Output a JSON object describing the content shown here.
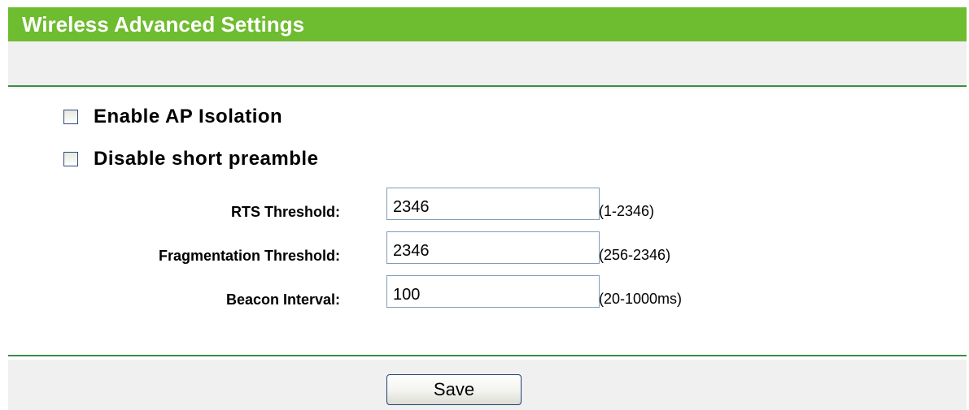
{
  "header": {
    "title": "Wireless Advanced Settings",
    "bar_color": "#6ebc2f",
    "rule_color": "#3a8f46"
  },
  "options": {
    "ap_isolation": {
      "label": "Enable AP Isolation",
      "checked": false
    },
    "short_preamble": {
      "label": "Disable short preamble",
      "checked": false
    }
  },
  "fields": {
    "rts": {
      "label": "RTS Threshold:",
      "value": "2346",
      "range": "(1-2346)"
    },
    "fragmentation": {
      "label": "Fragmentation Threshold:",
      "value": "2346",
      "range": "(256-2346)"
    },
    "beacon": {
      "label": "Beacon Interval:",
      "value": "100",
      "range": "(20-1000ms)"
    }
  },
  "actions": {
    "save_label": "Save"
  }
}
